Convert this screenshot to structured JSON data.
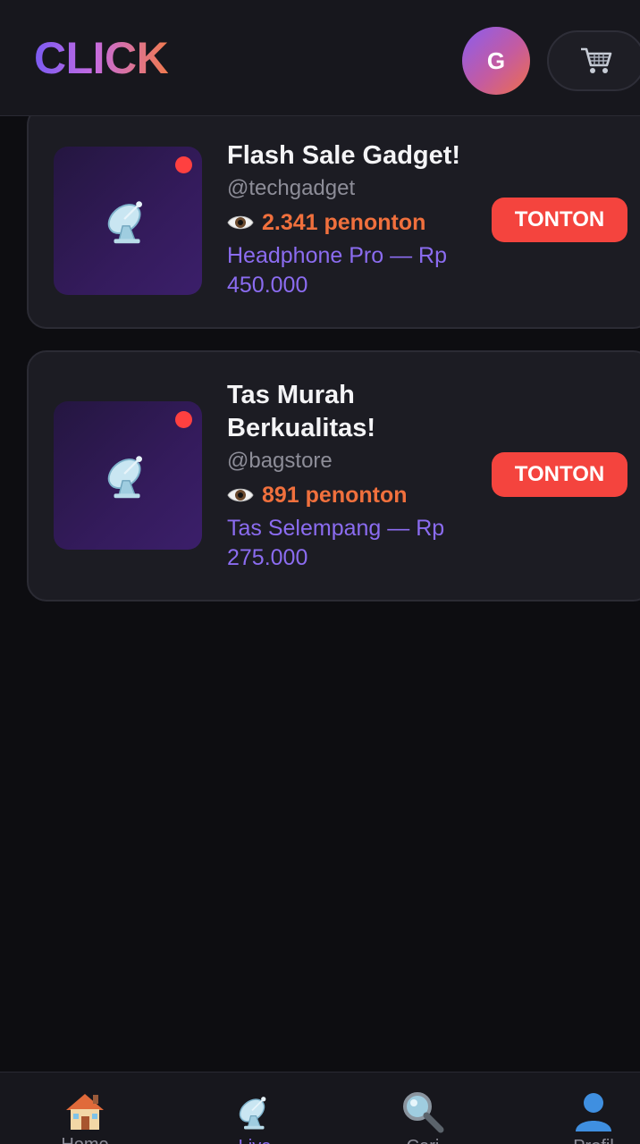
{
  "header": {
    "logo": "CLICK",
    "avatar_initial": "G",
    "cart_icon": "shopping-cart-icon"
  },
  "streams": [
    {
      "title": "Flash Sale Gadget!",
      "handle": "@techgadget",
      "viewers": "2.341 penonton",
      "product": "Headphone Pro — Rp 450.000",
      "thumbnail_icon": "satellite-dish-icon",
      "live": true,
      "button": "TONTON"
    },
    {
      "title": "Tas Murah Berkualitas!",
      "handle": "@bagstore",
      "viewers": "891 penonton",
      "product": "Tas Selempang — Rp 275.000",
      "thumbnail_icon": "satellite-dish-icon",
      "live": true,
      "button": "TONTON"
    }
  ],
  "bottom_nav": {
    "items": [
      {
        "icon": "home-icon",
        "label": "Home",
        "active": false
      },
      {
        "icon": "satellite-dish-icon",
        "label": "Live",
        "active": true
      },
      {
        "icon": "search-icon",
        "label": "Cari",
        "active": false
      },
      {
        "icon": "profile-icon",
        "label": "Profil",
        "active": false
      }
    ]
  },
  "colors": {
    "accent_purple": "#8b6cf0",
    "accent_orange": "#f0703d",
    "live_red": "#ff4040",
    "button_red": "#f4443e",
    "background": "#0d0d11",
    "card": "#1c1c23"
  }
}
